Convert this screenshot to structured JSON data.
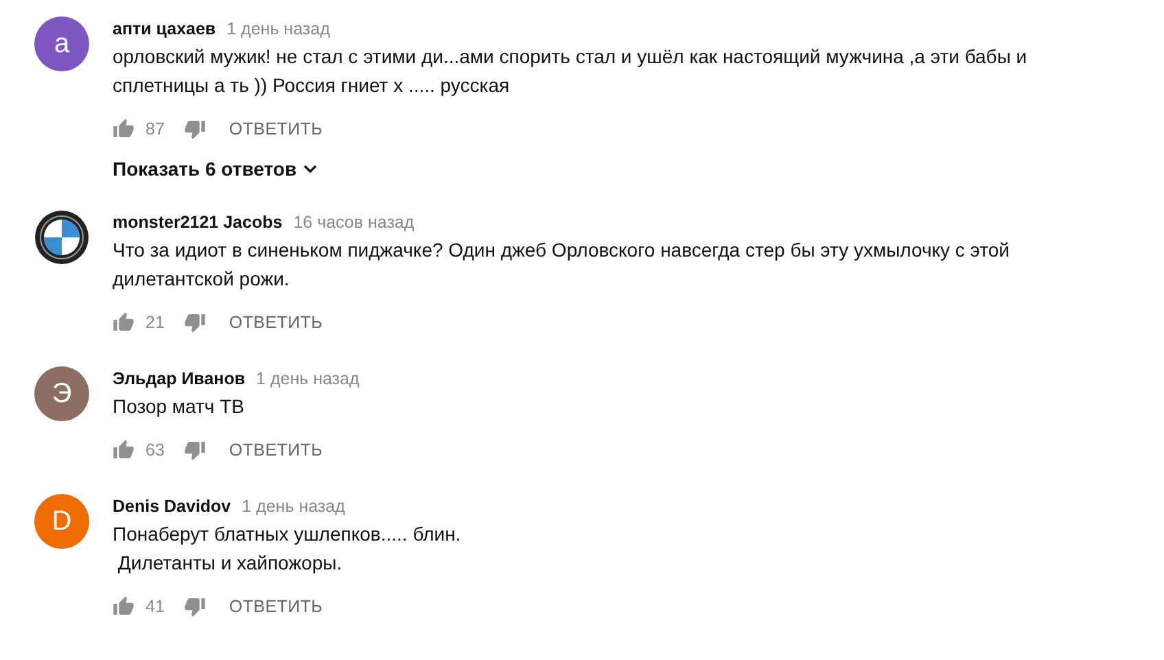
{
  "comments": [
    {
      "avatar": {
        "kind": "letter",
        "letter": "а",
        "color": "#7e57c2"
      },
      "author": "апти цахаев",
      "time": "1 день назад",
      "lines": [
        "орловский мужик! не стал с этими ди...ами спорить стал и ушёл как настоящий мужчина ,а эти бабы и",
        "сплетницы а ть )) Россия гниет х ..... русская"
      ],
      "likes": "87",
      "reply": "ОТВЕТИТЬ",
      "replies_toggle": "Показать 6 ответов"
    },
    {
      "author": "monster2121 Jacobs",
      "time": "16 часов назад",
      "lines": [
        "Что за идиот в синеньком пиджачке? Один джеб Орловского навсегда стер бы эту ухмылочку с этой",
        "дилетантской рожи."
      ],
      "likes": "21",
      "reply": "ОТВЕТИТЬ"
    },
    {
      "avatar": {
        "kind": "letter",
        "letter": "Э",
        "color": "#8d6e63"
      },
      "author": "Эльдар Иванов",
      "time": "1 день назад",
      "lines": [
        "Позор матч ТВ"
      ],
      "likes": "63",
      "reply": "ОТВЕТИТЬ"
    },
    {
      "avatar": {
        "kind": "letter",
        "letter": "D",
        "color": "#ef6c00"
      },
      "author": "Denis Davidov",
      "time": "1 день назад",
      "lines": [
        "Понаберут блатных ушлепков..... блин.",
        " Дилетанты и хайпожоры."
      ],
      "likes": "41",
      "reply": "ОТВЕТИТЬ"
    }
  ]
}
